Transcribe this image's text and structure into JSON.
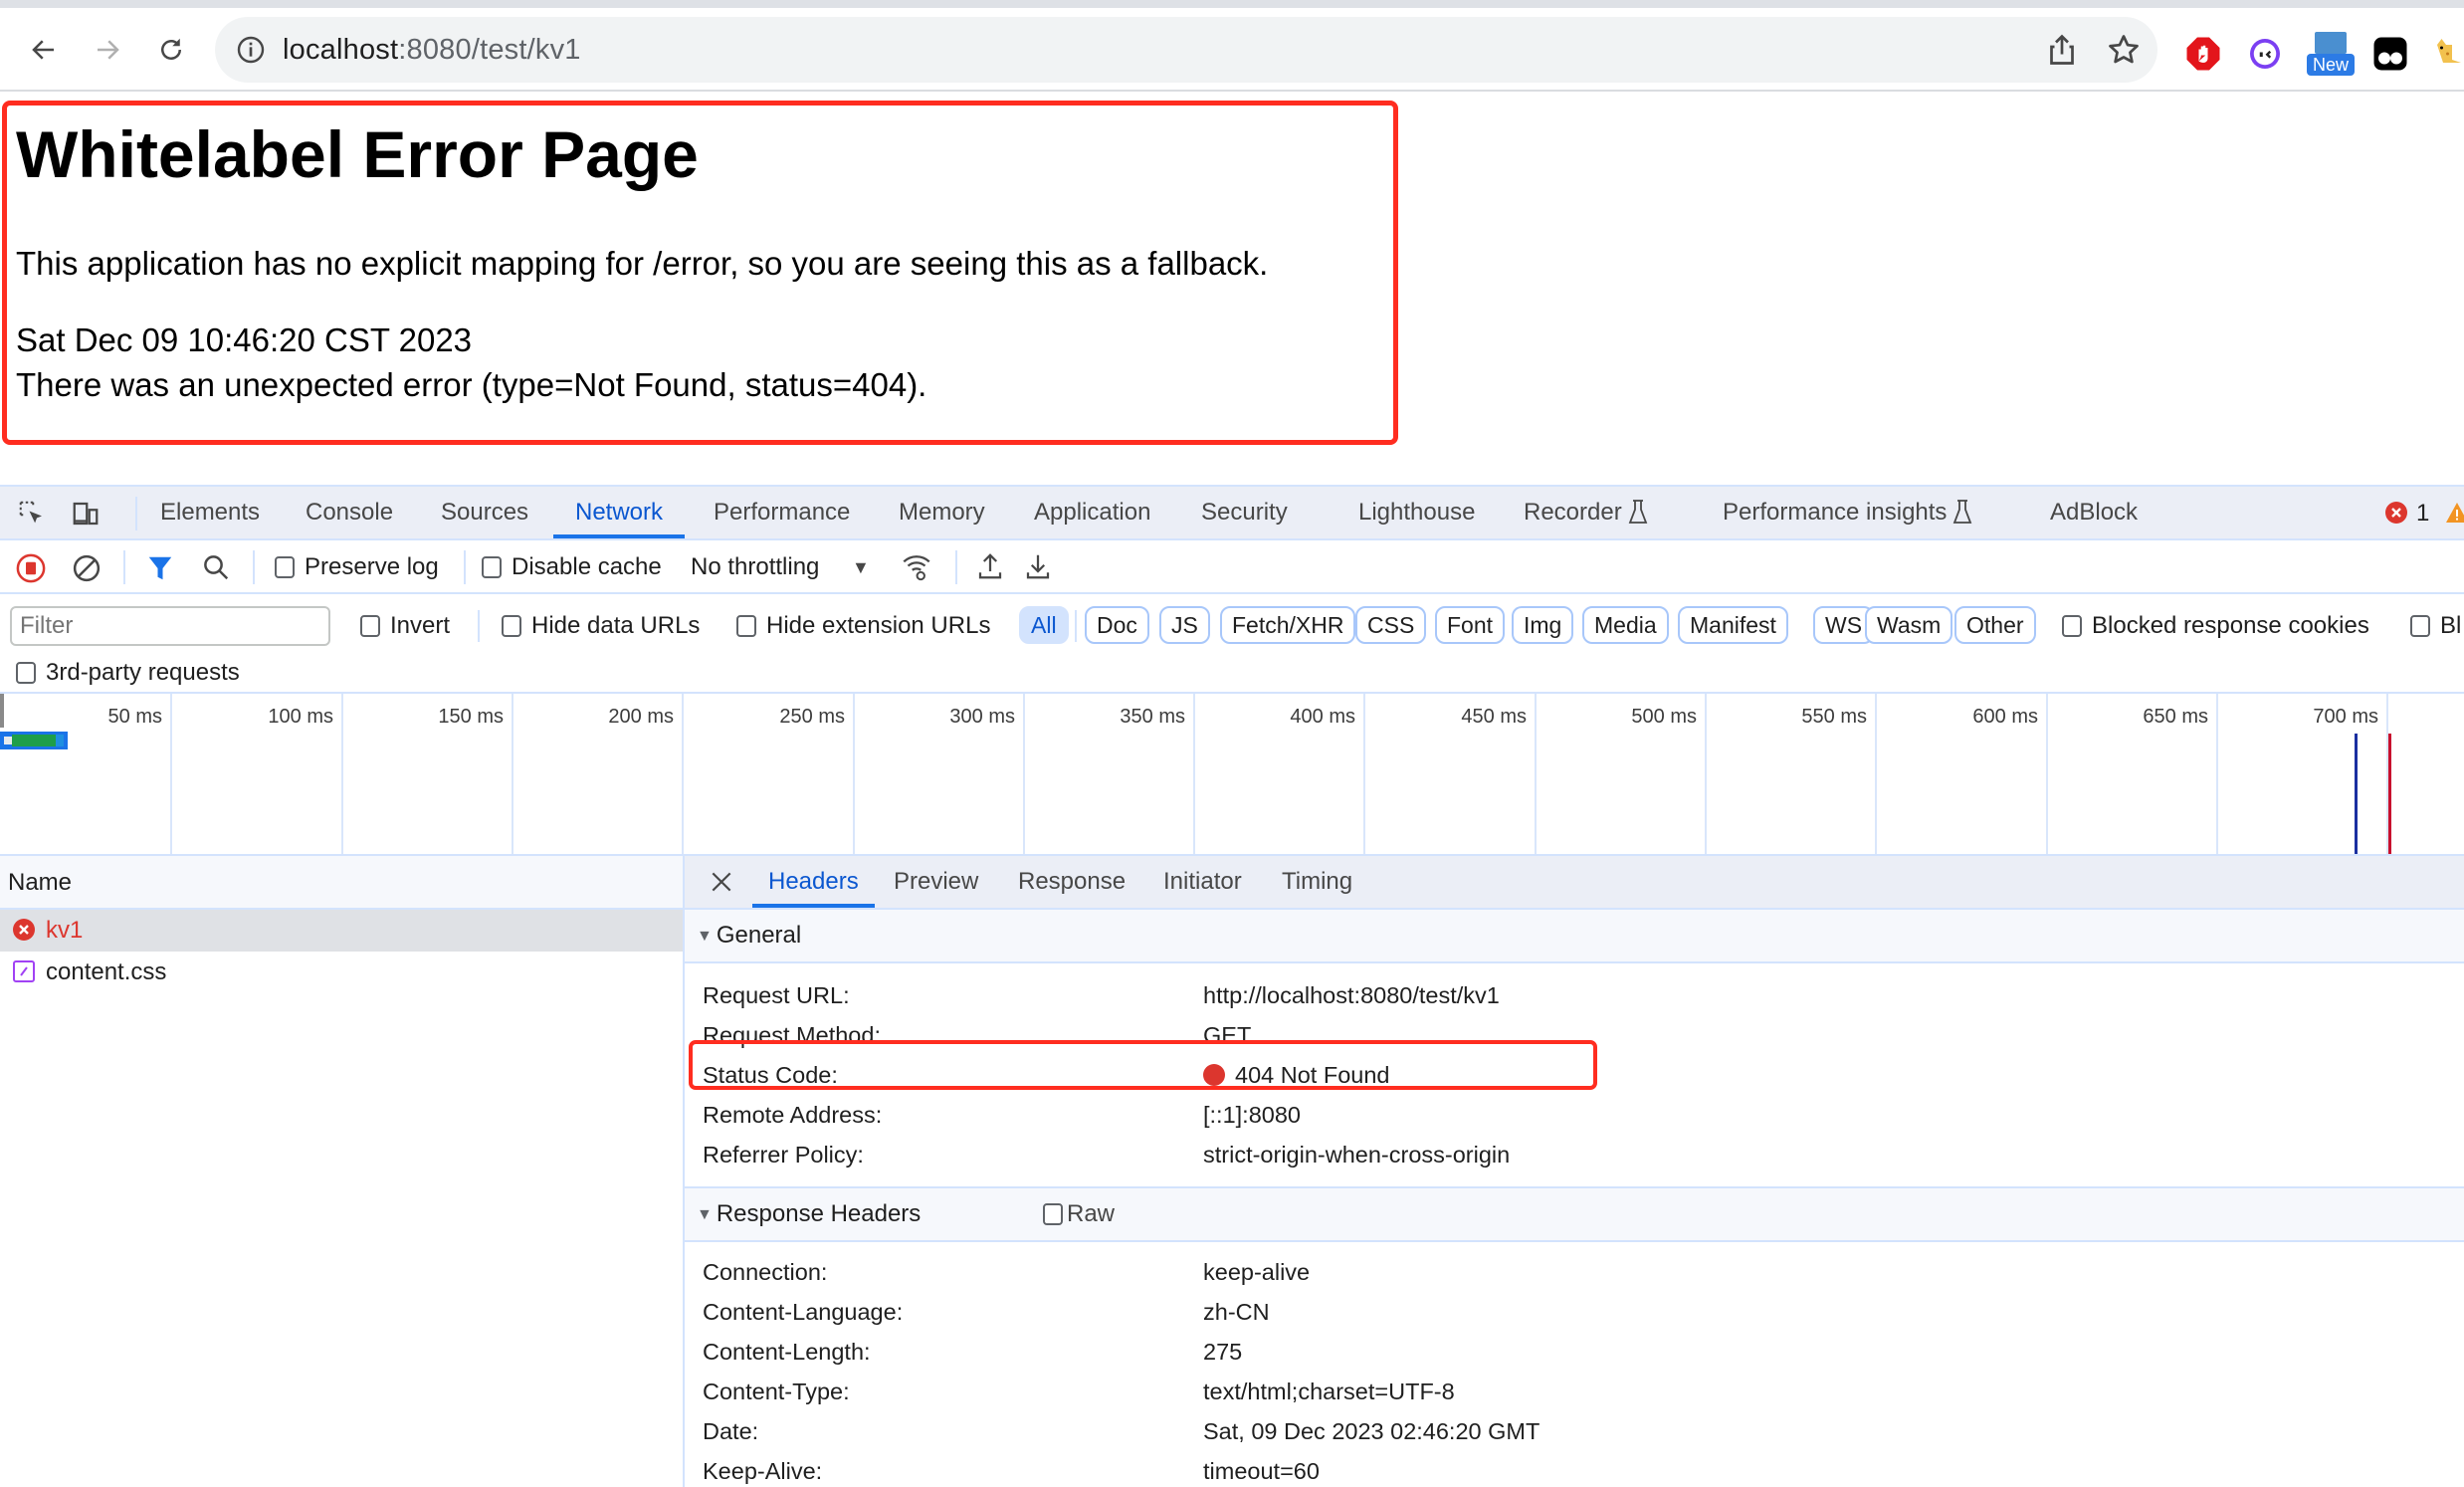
{
  "browser": {
    "url_host": "localhost",
    "url_rest": ":8080/test/kv1",
    "extensions": [
      {
        "name": "adblock-icon"
      },
      {
        "name": "assistant-icon"
      },
      {
        "name": "new-extension-icon",
        "badge": "New"
      },
      {
        "name": "tampermonkey-icon"
      },
      {
        "name": "cat-extension-icon"
      }
    ]
  },
  "page": {
    "title": "Whitelabel Error Page",
    "message": "This application has no explicit mapping for /error, so you are seeing this as a fallback.",
    "timestamp": "Sat Dec 09 10:46:20 CST 2023",
    "error_line": "There was an unexpected error (type=Not Found, status=404)."
  },
  "devtools": {
    "tabs": [
      "Elements",
      "Console",
      "Sources",
      "Network",
      "Performance",
      "Memory",
      "Application",
      "Security",
      "Lighthouse",
      "Recorder",
      "Performance insights",
      "AdBlock"
    ],
    "active_tab": "Network",
    "error_count": "1",
    "toolbar": {
      "preserve_log": "Preserve log",
      "disable_cache": "Disable cache",
      "throttling": "No throttling"
    },
    "filter": {
      "placeholder": "Filter",
      "invert": "Invert",
      "hide_data_urls": "Hide data URLs",
      "hide_extension_urls": "Hide extension URLs",
      "types": [
        "All",
        "Doc",
        "JS",
        "Fetch/XHR",
        "CSS",
        "Font",
        "Img",
        "Media",
        "Manifest",
        "WS",
        "Wasm",
        "Other"
      ],
      "active_type": "All",
      "blocked_response_cookies": "Blocked response cookies",
      "blocked_requests_truncated": "Bl",
      "third_party": "3rd-party requests"
    },
    "timeline": {
      "ticks": [
        "50 ms",
        "100 ms",
        "150 ms",
        "200 ms",
        "250 ms",
        "300 ms",
        "350 ms",
        "400 ms",
        "450 ms",
        "500 ms",
        "550 ms",
        "600 ms",
        "650 ms",
        "700 ms"
      ],
      "dom_content_loaded_ms": 688,
      "load_ms": 698
    },
    "requests": {
      "column_header": "Name",
      "rows": [
        {
          "name": "kv1",
          "status": "error",
          "selected": true
        },
        {
          "name": "content.css",
          "status": "ok",
          "selected": false
        }
      ]
    },
    "details": {
      "tabs": [
        "Headers",
        "Preview",
        "Response",
        "Initiator",
        "Timing"
      ],
      "active_tab": "Headers",
      "general": {
        "title": "General",
        "rows": [
          {
            "label": "Request URL:",
            "value": "http://localhost:8080/test/kv1"
          },
          {
            "label": "Request Method:",
            "value": "GET"
          },
          {
            "label": "Status Code:",
            "value": "404 Not Found"
          },
          {
            "label": "Remote Address:",
            "value": "[::1]:8080"
          },
          {
            "label": "Referrer Policy:",
            "value": "strict-origin-when-cross-origin"
          }
        ]
      },
      "response_headers": {
        "title": "Response Headers",
        "raw_label": "Raw",
        "rows": [
          {
            "label": "Connection:",
            "value": "keep-alive"
          },
          {
            "label": "Content-Language:",
            "value": "zh-CN"
          },
          {
            "label": "Content-Length:",
            "value": "275"
          },
          {
            "label": "Content-Type:",
            "value": "text/html;charset=UTF-8"
          },
          {
            "label": "Date:",
            "value": "Sat, 09 Dec 2023 02:46:20 GMT"
          },
          {
            "label": "Keep-Alive:",
            "value": "timeout=60"
          }
        ]
      }
    }
  },
  "colors": {
    "accent": "#1a73e8",
    "active_text": "#0b57d0",
    "error": "#dc362e",
    "annotation": "#ff2d20"
  }
}
